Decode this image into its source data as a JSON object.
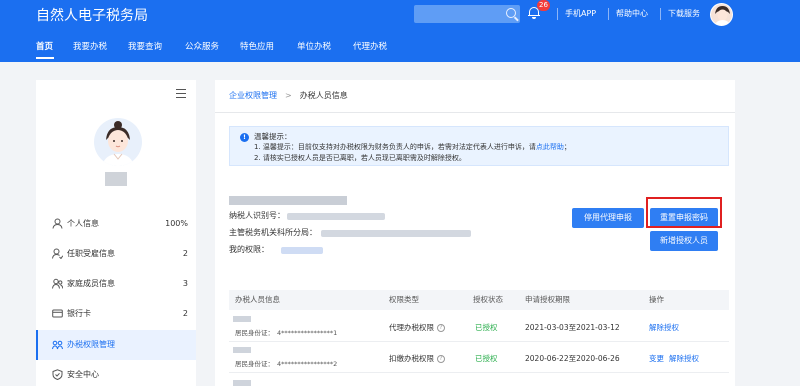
{
  "header": {
    "app_title": "自然人电子税务局",
    "search_placeholder": "",
    "notification_count": "26",
    "links": [
      "手机APP",
      "帮助中心",
      "下载服务"
    ]
  },
  "nav": {
    "items": [
      "首页",
      "我要办税",
      "我要查询",
      "公众服务",
      "特色应用",
      "单位办税",
      "代理办税"
    ],
    "active_index": 0
  },
  "left_menu": {
    "items": [
      {
        "label": "个人信息",
        "value": "100%",
        "icon": "person-icon"
      },
      {
        "label": "任职受雇信息",
        "value": "2",
        "icon": "employment-icon"
      },
      {
        "label": "家庭成员信息",
        "value": "3",
        "icon": "family-icon"
      },
      {
        "label": "银行卡",
        "value": "2",
        "icon": "bank-card-icon"
      },
      {
        "label": "办税权限管理",
        "value": "",
        "icon": "permission-icon"
      },
      {
        "label": "安全中心",
        "value": "",
        "icon": "shield-icon"
      }
    ],
    "active_index": 4
  },
  "breadcrumb": {
    "parent": "企业权限管理",
    "current": "办税人员信息"
  },
  "notice": {
    "title": "温馨提示：",
    "line1_a": "1. 温馨提示：目前仅支持对办税权限为财务负责人的申诉，若需对法定代表人进行申诉，请",
    "line1_link": "点此帮助",
    "line1_b": "；",
    "line2": "2. 请核实已授权人员是否已离职，若人员现已离职需及时解除授权。"
  },
  "info": {
    "taxpayer_id_label": "纳税人识别号：",
    "tax_office_label": "主管税务机关科所分局：",
    "my_permission_label": "我的权限："
  },
  "buttons": {
    "stop_agent": "停用代理申报",
    "reset_password": "重置申报密码",
    "add_authorized": "新增授权人员"
  },
  "table": {
    "headers": [
      "办税人员信息",
      "权限类型",
      "授权状态",
      "申请授权期限",
      "操作"
    ],
    "rows": [
      {
        "id_label": "居民身份证：",
        "id_value": "4****************1",
        "permission_type": "代理办税权限",
        "status": "已授权",
        "period": "2021-03-03至2021-03-12",
        "actions": [
          "解除授权"
        ]
      },
      {
        "id_label": "居民身份证：",
        "id_value": "4****************2",
        "permission_type": "扣缴办税权限",
        "status": "已授权",
        "period": "2020-06-22至2020-06-26",
        "actions": [
          "变更",
          "解除授权"
        ]
      }
    ]
  },
  "colors": {
    "brand_blue": "#1b6ff0",
    "button_blue": "#2f7ef3",
    "status_green": "#2aae4c",
    "highlight_red": "#e02020"
  }
}
